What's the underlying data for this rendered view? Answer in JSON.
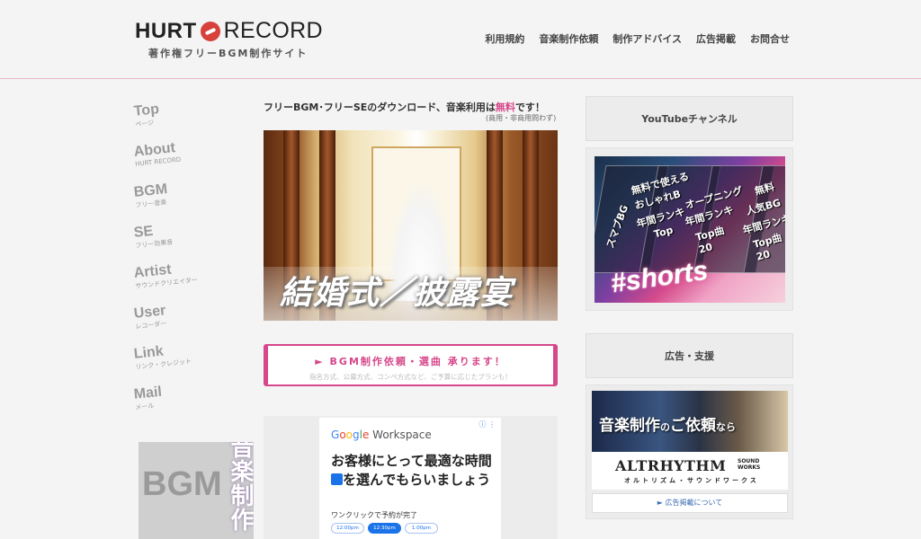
{
  "header": {
    "logo_left": "HURT",
    "logo_right": "RECORD",
    "tagline": "著作権フリーBGM制作サイト",
    "nav": [
      "利用規約",
      "音楽制作依頼",
      "制作アドバイス",
      "広告掲載",
      "お問合せ"
    ]
  },
  "sidenav": {
    "items": [
      {
        "en": "Top",
        "jp": "ページ"
      },
      {
        "en": "About",
        "jp": "HURT RECORD"
      },
      {
        "en": "BGM",
        "jp": "フリー音楽"
      },
      {
        "en": "SE",
        "jp": "フリー効果音"
      },
      {
        "en": "Artist",
        "jp": "サウンドクリエイター"
      },
      {
        "en": "User",
        "jp": "レコーダー"
      },
      {
        "en": "Link",
        "jp": "リンク・クレジット"
      },
      {
        "en": "Mail",
        "jp": "メール"
      }
    ],
    "banner_text": "BGM",
    "banner_vertical": "音楽制作"
  },
  "main": {
    "intro_prefix": "フリーBGM･フリーSEのダウンロード、音楽利用は",
    "intro_free": "無料",
    "intro_suffix": "です！",
    "intro_note": "(商用・非商用問わず)",
    "hero_caption": "結婚式／披露宴",
    "cta_main": "► BGM制作依頼・選曲 承ります！",
    "cta_sub": "指名方式、公募方式、コンペ方式など、ご予算に応じたプランも！"
  },
  "ad_google": {
    "brand_g": "G",
    "brand_o1": "o",
    "brand_o2": "o",
    "brand_g2": "g",
    "brand_l": "l",
    "brand_e": "e",
    "brand_rest": " Workspace",
    "info": "ⓘ ⋮",
    "headline_1": "お客様にとって最適な時間",
    "headline_2": "を選んでもらいましょう",
    "sub": "ワンクリックで予約が完了",
    "slots": [
      "12:00pm",
      "12:30pm",
      "1:00pm"
    ]
  },
  "right": {
    "youtube_title": "YouTubeチャンネル",
    "yt_labels": [
      "無料で使える",
      "おしゃれB",
      "年間ランキ",
      "Top",
      "オープニング",
      "年間ランキ",
      "Top曲",
      "20",
      "無料",
      "人気BG",
      "年間ランキン",
      "Top曲",
      "スマブBG",
      "20"
    ],
    "yt_shorts": "#shorts",
    "ads_title": "広告・支援",
    "ad2_head_1": "音楽制作",
    "ad2_head_small": "の",
    "ad2_head_2": "ご依頼",
    "ad2_head_small2": "なら",
    "ad2_brand": "ALTRHYTHM",
    "ad2_brand_sub_1": "SOUND",
    "ad2_brand_sub_2": "WORKS",
    "ad2_kana": "オルトリズム・サウンドワークス",
    "ad2_link": "► 広告掲載について"
  }
}
